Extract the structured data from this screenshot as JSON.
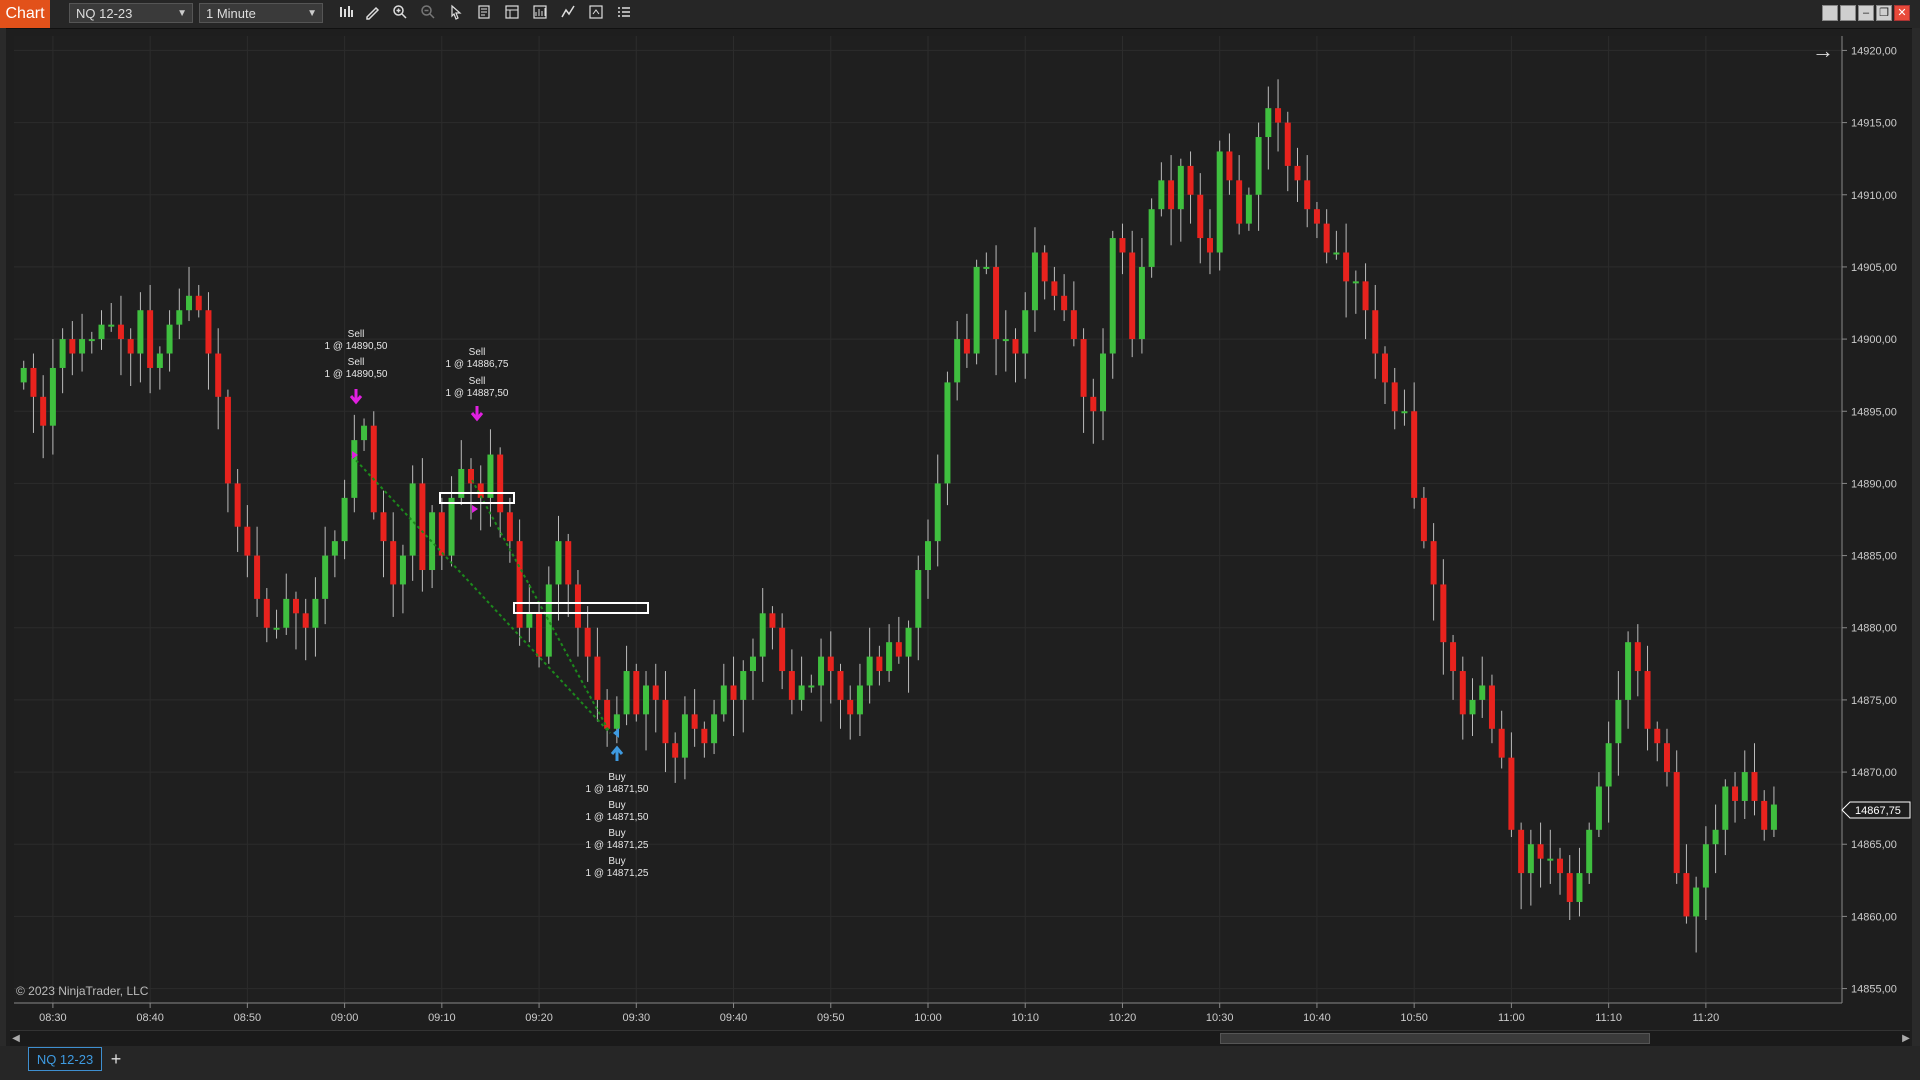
{
  "toolbar": {
    "chart_label": "Chart",
    "instrument": "NQ 12-23",
    "interval": "1 Minute",
    "icons": [
      "bar-type-icon",
      "draw-pencil-icon",
      "zoom-in-icon",
      "zoom-out-icon",
      "pointer-icon",
      "data-box-icon",
      "properties-icon",
      "strategies-icon",
      "indicators-icon",
      "chart-trader-icon",
      "templates-icon"
    ]
  },
  "copyright": "© 2023 NinjaTrader, LLC",
  "last_price_label": "14867,75",
  "bottom_tab": "NQ 12-23",
  "add_tab_label": "+",
  "chart_data": {
    "type": "candlestick",
    "ylim": [
      14854,
      14921
    ],
    "xlim": [
      "08:26",
      "11:34"
    ],
    "y_ticks": [
      "14920,00",
      "14915,00",
      "14910,00",
      "14905,00",
      "14900,00",
      "14895,00",
      "14890,00",
      "14885,00",
      "14880,00",
      "14875,00",
      "14870,00",
      "14865,00",
      "14860,00",
      "14855,00"
    ],
    "y_tick_values": [
      14920,
      14915,
      14910,
      14905,
      14900,
      14895,
      14890,
      14885,
      14880,
      14875,
      14870,
      14865,
      14860,
      14855
    ],
    "x_ticks": [
      "08:30",
      "08:40",
      "08:50",
      "09:00",
      "09:10",
      "09:20",
      "09:30",
      "09:40",
      "09:50",
      "10:00",
      "10:10",
      "10:20",
      "10:30",
      "10:40",
      "10:50",
      "11:00",
      "11:10",
      "11:20"
    ],
    "up_color": "#3fbf3f",
    "down_color": "#e8231e",
    "last_price": 14867.75,
    "closes": [
      14898,
      14896,
      14894,
      14898,
      14900,
      14899,
      14900,
      14900,
      14901,
      14901,
      14900,
      14899,
      14902,
      14898,
      14899,
      14901,
      14902,
      14903,
      14902,
      14899,
      14896,
      14890,
      14887,
      14885,
      14882,
      14880,
      14880,
      14882,
      14881,
      14880,
      14882,
      14885,
      14886,
      14889,
      14893,
      14894,
      14888,
      14886,
      14883,
      14885,
      14890,
      14884,
      14888,
      14885,
      14889,
      14891,
      14890,
      14889,
      14892,
      14888,
      14886,
      14880,
      14881,
      14878,
      14883,
      14886,
      14883,
      14880,
      14878,
      14875,
      14873,
      14874,
      14877,
      14874,
      14876,
      14875,
      14872,
      14871,
      14874,
      14873,
      14872,
      14874,
      14876,
      14875,
      14877,
      14878,
      14881,
      14880,
      14877,
      14875,
      14876,
      14876,
      14878,
      14877,
      14875,
      14874,
      14876,
      14878,
      14877,
      14879,
      14878,
      14880,
      14884,
      14886,
      14890,
      14897,
      14900,
      14899,
      14905,
      14905,
      14900,
      14900,
      14899,
      14902,
      14906,
      14904,
      14903,
      14902,
      14900,
      14896,
      14895,
      14899,
      14907,
      14906,
      14900,
      14905,
      14909,
      14911,
      14909,
      14912,
      14910,
      14907,
      14906,
      14913,
      14911,
      14908,
      14910,
      14914,
      14916,
      14915,
      14912,
      14911,
      14909,
      14908,
      14906,
      14906,
      14904,
      14904,
      14902,
      14899,
      14897,
      14895,
      14895,
      14889,
      14886,
      14883,
      14879,
      14877,
      14874,
      14875,
      14876,
      14873,
      14871,
      14866,
      14863,
      14865,
      14864,
      14864,
      14863,
      14861,
      14863,
      14866,
      14869,
      14872,
      14875,
      14879,
      14877,
      14873,
      14872,
      14870,
      14863,
      14860,
      14862,
      14865,
      14866,
      14869,
      14868,
      14870,
      14868,
      14866,
      14867.75
    ]
  },
  "annotations": {
    "sell1_line1": "Sell",
    "sell1_line2": "1 @ 14890,50",
    "sell2_line1": "Sell",
    "sell2_line2": "1 @ 14890,50",
    "sell3_line1": "Sell",
    "sell3_line2": "1 @ 14886,75",
    "sell4_line1": "Sell",
    "sell4_line2": "1 @ 14887,50",
    "buy1_line1": "Buy",
    "buy1_line2": "1 @ 14871,50",
    "buy2_line1": "Buy",
    "buy2_line2": "1 @ 14871,50",
    "buy3_line1": "Buy",
    "buy3_line2": "1 @ 14871,25",
    "buy4_line1": "Buy",
    "buy4_line2": "1 @ 14871,25"
  }
}
